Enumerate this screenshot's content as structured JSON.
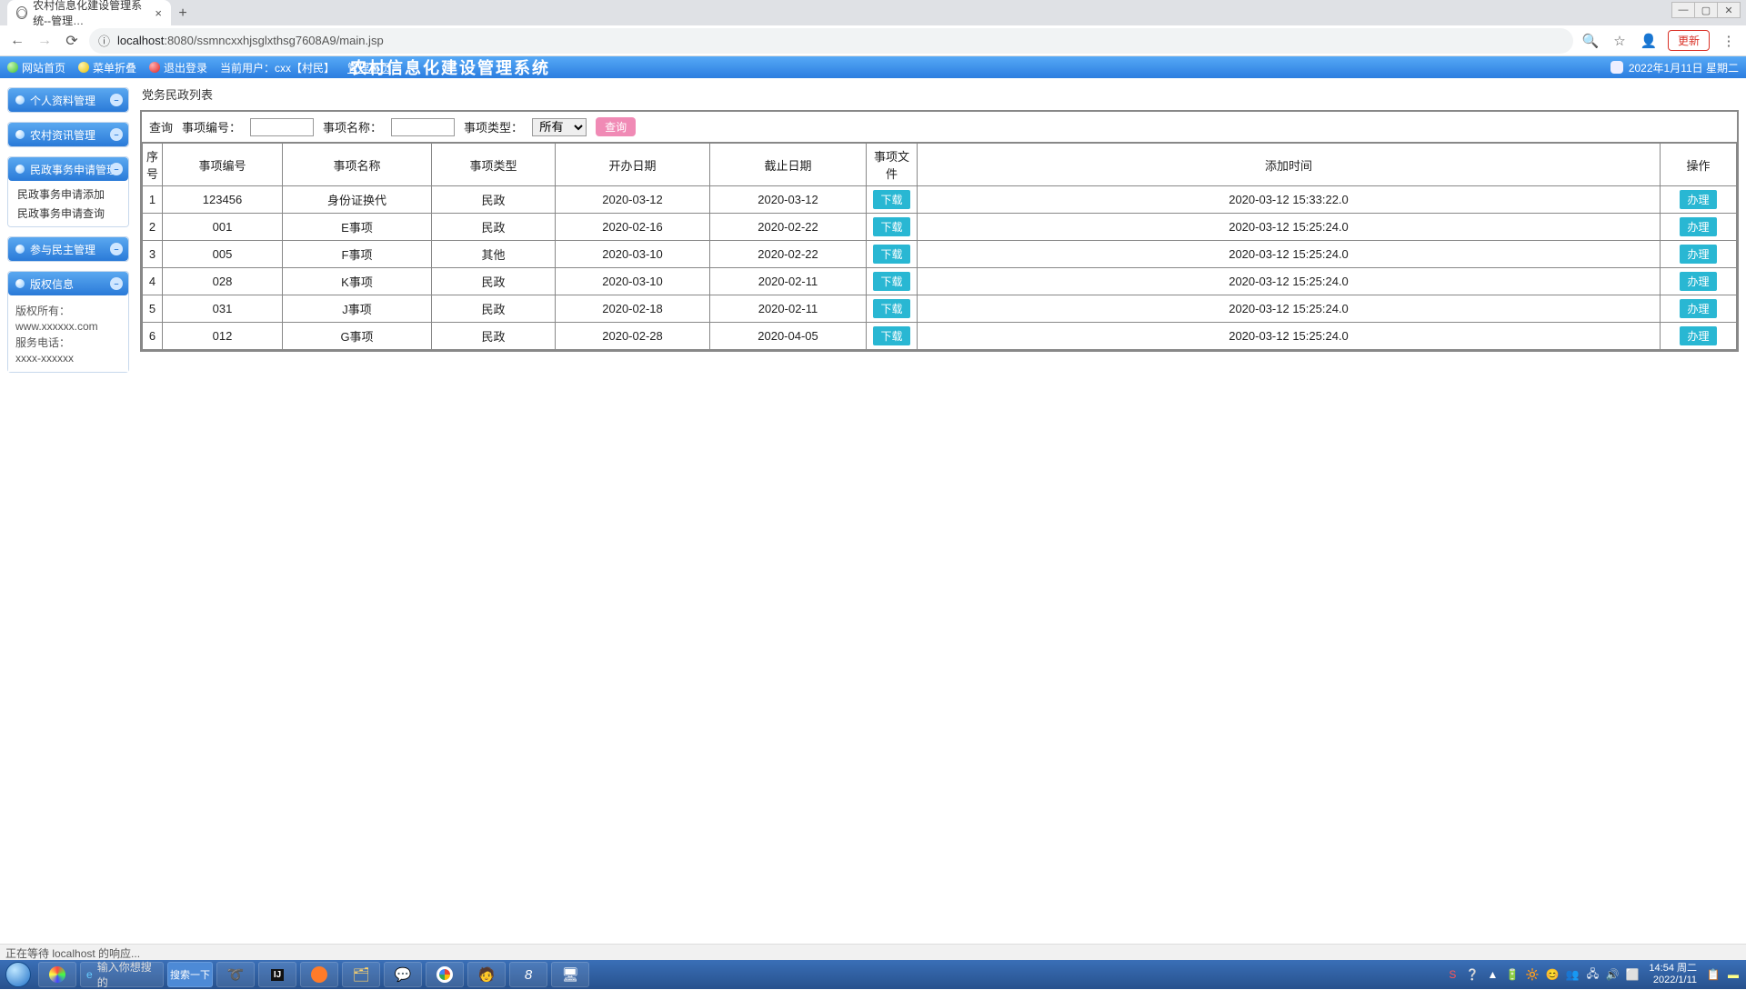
{
  "chrome": {
    "tab_title": "农村信息化建设管理系统--管理…",
    "url_info_icon": "ⓘ",
    "url_host": "localhost",
    "url_port_path": ":8080/ssmncxxhjsglxthsg7608A9/main.jsp",
    "update_label": "更新"
  },
  "topbar": {
    "home": "网站首页",
    "menu": "菜单折叠",
    "logout": "退出登录",
    "current_user": "当前用户：cxx【村民】",
    "admin_home": "管理首页",
    "system_title": "农村信息化建设管理系统",
    "datetime": "2022年1月11日  星期二"
  },
  "sidebar": {
    "items": [
      {
        "label": "个人资料管理",
        "sub": []
      },
      {
        "label": "农村资讯管理",
        "sub": []
      },
      {
        "label": "民政事务申请管理",
        "sub": [
          "民政事务申请添加",
          "民政事务申请查询"
        ]
      },
      {
        "label": "参与民主管理",
        "sub": []
      }
    ],
    "copyright_head": "版权信息",
    "copyright": [
      "版权所有：",
      "www.xxxxxx.com",
      "服务电话：",
      "xxxx-xxxxxx"
    ]
  },
  "main": {
    "crumb": "党务民政列表",
    "search": {
      "query_label": "查询",
      "code_label": "事项编号：",
      "name_label": "事项名称：",
      "type_label": "事项类型：",
      "type_selected": "所有",
      "submit": "查询"
    },
    "headers": [
      "序号",
      "事项编号",
      "事项名称",
      "事项类型",
      "开办日期",
      "截止日期",
      "事项文件",
      "添加时间",
      "操作"
    ],
    "file_btn": "下载",
    "op_btn": "办理",
    "rows": [
      {
        "seq": "1",
        "code": "123456",
        "name": "身份证换代",
        "type": "民政",
        "start": "2020-03-12",
        "end": "2020-03-12",
        "added": "2020-03-12 15:33:22.0"
      },
      {
        "seq": "2",
        "code": "001",
        "name": "E事项",
        "type": "民政",
        "start": "2020-02-16",
        "end": "2020-02-22",
        "added": "2020-03-12 15:25:24.0"
      },
      {
        "seq": "3",
        "code": "005",
        "name": "F事项",
        "type": "其他",
        "start": "2020-03-10",
        "end": "2020-02-22",
        "added": "2020-03-12 15:25:24.0"
      },
      {
        "seq": "4",
        "code": "028",
        "name": "K事项",
        "type": "民政",
        "start": "2020-03-10",
        "end": "2020-02-11",
        "added": "2020-03-12 15:25:24.0"
      },
      {
        "seq": "5",
        "code": "031",
        "name": "J事项",
        "type": "民政",
        "start": "2020-02-18",
        "end": "2020-02-11",
        "added": "2020-03-12 15:25:24.0"
      },
      {
        "seq": "6",
        "code": "012",
        "name": "G事项",
        "type": "民政",
        "start": "2020-02-28",
        "end": "2020-04-05",
        "added": "2020-03-12 15:25:24.0"
      }
    ]
  },
  "status": "正在等待 localhost 的响应...",
  "taskbar": {
    "search_placeholder": "输入你想搜的",
    "search_btn": "搜索一下",
    "clock_time": "14:54 周二",
    "clock_date": "2022/1/11"
  }
}
